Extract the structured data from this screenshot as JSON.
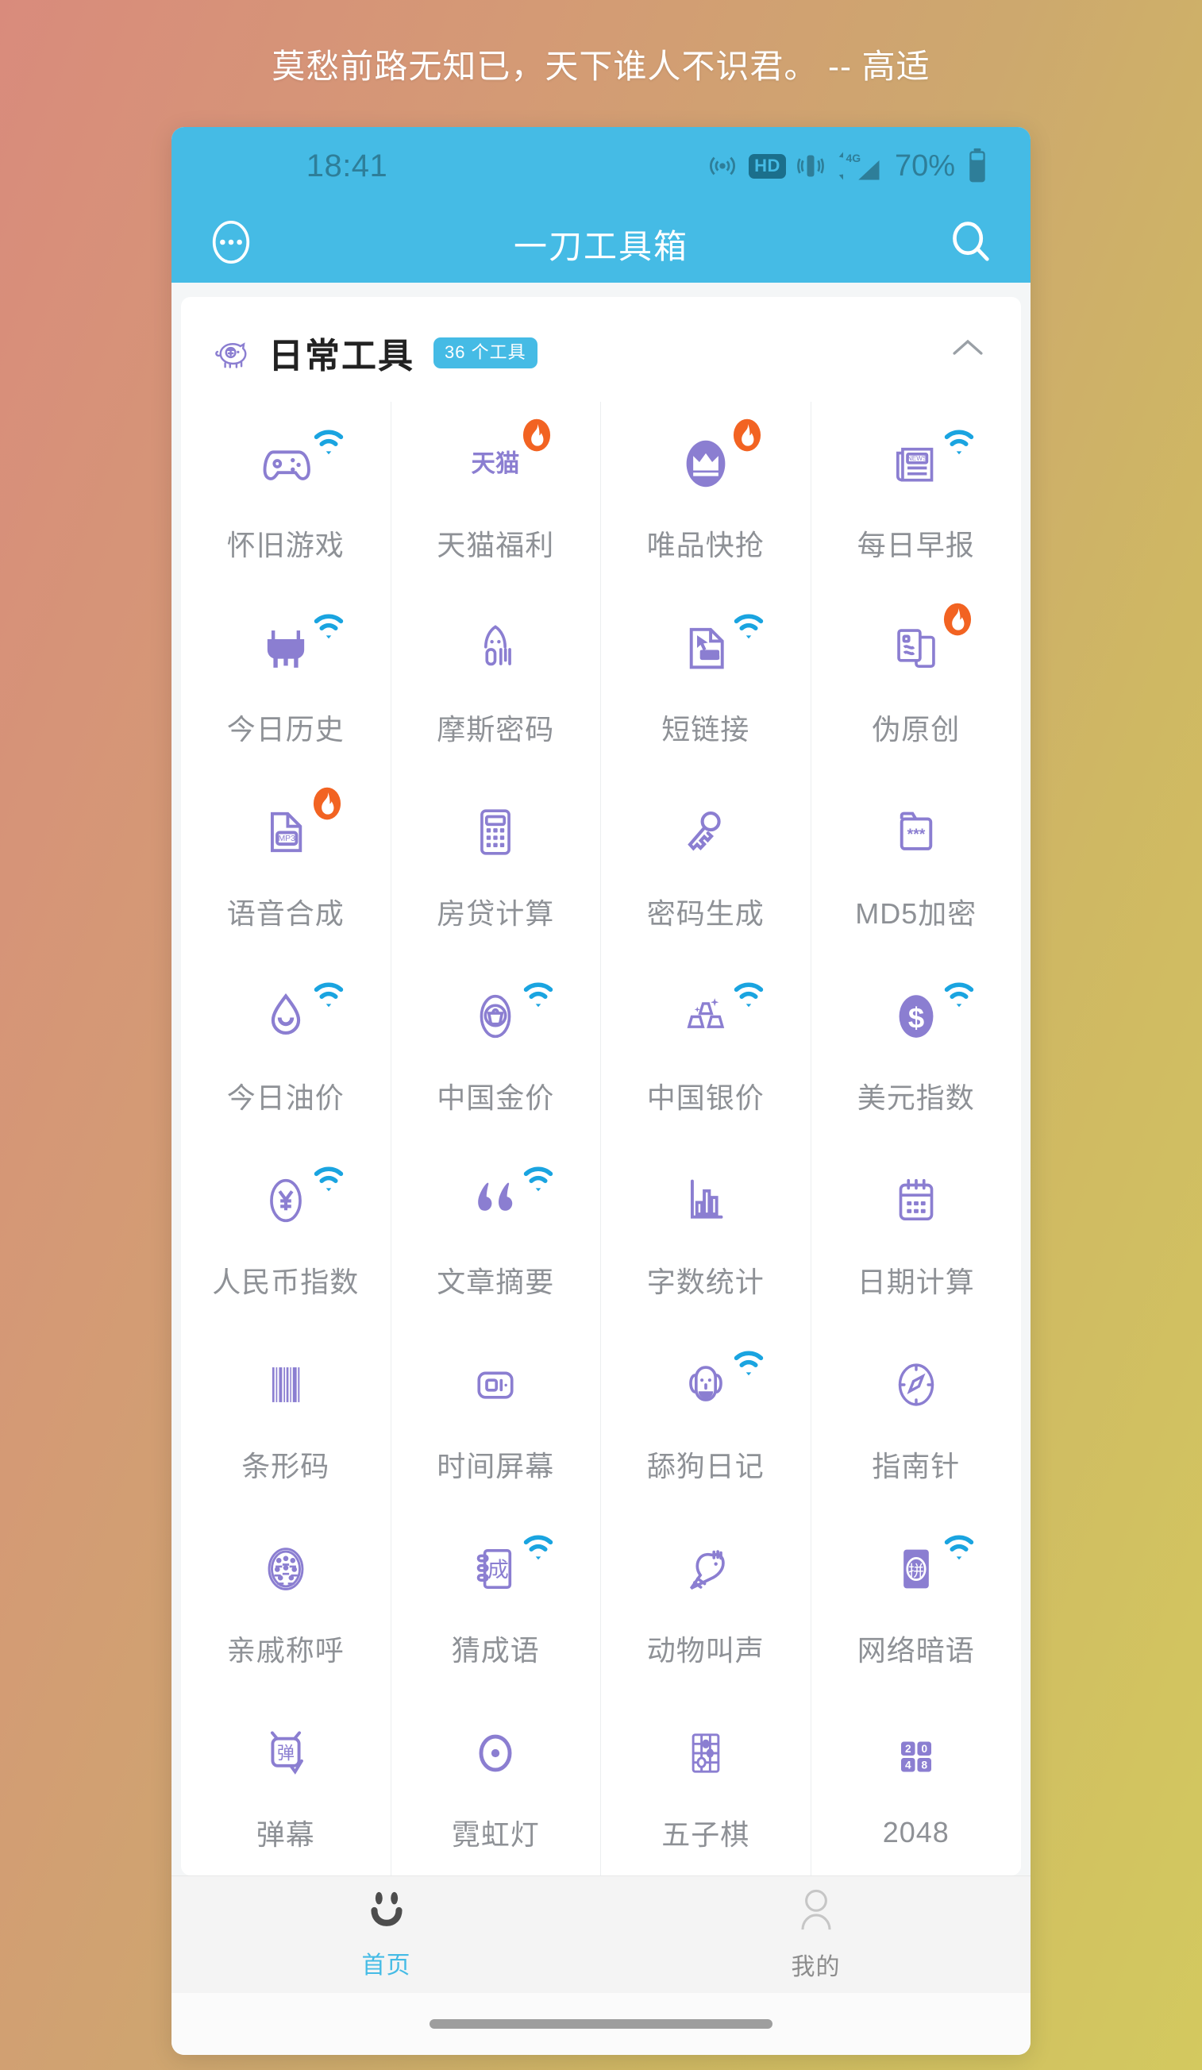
{
  "caption": "莫愁前路无知已，天下谁人不识君。 -- 高适",
  "status_bar": {
    "time": "18:41",
    "battery_percent": "70%",
    "hd_label": "HD",
    "network_label": "4G"
  },
  "app_bar": {
    "title": "一刀工具箱",
    "more_icon": "more-dots-icon",
    "search_icon": "search-icon"
  },
  "section": {
    "icon": "piggy-bank-icon",
    "title": "日常工具",
    "badge": "36 个工具",
    "collapse_icon": "chevron-up-icon"
  },
  "colors": {
    "accent": "#45bbe5",
    "icon_purple": "#8b7ed1",
    "badge_fire": "#f26322",
    "label_gray": "#8e9196"
  },
  "tools": [
    {
      "label": "怀旧游戏",
      "icon": "gamepad-icon",
      "badge": "wifi"
    },
    {
      "label": "天猫福利",
      "icon": "tmall-text-icon",
      "badge": "fire"
    },
    {
      "label": "唯品快抢",
      "icon": "crown-icon",
      "badge": "fire"
    },
    {
      "label": "每日早报",
      "icon": "newspaper-icon",
      "badge": "wifi"
    },
    {
      "label": "今日历史",
      "icon": "ding-cauldron-icon",
      "badge": "wifi"
    },
    {
      "label": "摩斯密码",
      "icon": "morse-code-icon",
      "badge": "none"
    },
    {
      "label": "短链接",
      "icon": "url-file-icon",
      "badge": "wifi"
    },
    {
      "label": "伪原创",
      "icon": "document-copy-icon",
      "badge": "fire"
    },
    {
      "label": "语音合成",
      "icon": "mp3-file-icon",
      "badge": "fire"
    },
    {
      "label": "房贷计算",
      "icon": "calculator-icon",
      "badge": "none"
    },
    {
      "label": "密码生成",
      "icon": "key-icon",
      "badge": "none"
    },
    {
      "label": "MD5加密",
      "icon": "locked-folder-icon",
      "badge": "none"
    },
    {
      "label": "今日油价",
      "icon": "oil-drop-icon",
      "badge": "wifi"
    },
    {
      "label": "中国金价",
      "icon": "gold-ingot-icon",
      "badge": "wifi"
    },
    {
      "label": "中国银价",
      "icon": "silver-bars-icon",
      "badge": "wifi"
    },
    {
      "label": "美元指数",
      "icon": "dollar-coin-icon",
      "badge": "wifi"
    },
    {
      "label": "人民币指数",
      "icon": "yuan-coin-icon",
      "badge": "wifi"
    },
    {
      "label": "文章摘要",
      "icon": "quote-marks-icon",
      "badge": "wifi"
    },
    {
      "label": "字数统计",
      "icon": "bar-chart-icon",
      "badge": "none"
    },
    {
      "label": "日期计算",
      "icon": "calendar-icon",
      "badge": "none"
    },
    {
      "label": "条形码",
      "icon": "barcode-icon",
      "badge": "none"
    },
    {
      "label": "时间屏幕",
      "icon": "screen-icon",
      "badge": "none"
    },
    {
      "label": "舔狗日记",
      "icon": "dog-icon",
      "badge": "wifi"
    },
    {
      "label": "指南针",
      "icon": "compass-icon",
      "badge": "none"
    },
    {
      "label": "亲戚称呼",
      "icon": "family-circle-icon",
      "badge": "none"
    },
    {
      "label": "猜成语",
      "icon": "idiom-book-icon",
      "badge": "wifi"
    },
    {
      "label": "动物叫声",
      "icon": "bird-icon",
      "badge": "none"
    },
    {
      "label": "网络暗语",
      "icon": "pinyin-card-icon",
      "badge": "wifi"
    },
    {
      "label": "弹幕",
      "icon": "danmaku-icon",
      "badge": "none"
    },
    {
      "label": "霓虹灯",
      "icon": "neon-light-icon",
      "badge": "none"
    },
    {
      "label": "五子棋",
      "icon": "gomoku-board-icon",
      "badge": "none"
    },
    {
      "label": "2048",
      "icon": "2048-tiles-icon",
      "badge": "none"
    }
  ],
  "tab_bar": {
    "tabs": [
      {
        "label": "首页",
        "icon": "smiley-face-icon",
        "active": true
      },
      {
        "label": "我的",
        "icon": "person-icon",
        "active": false
      }
    ]
  }
}
